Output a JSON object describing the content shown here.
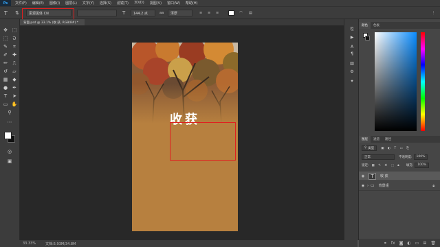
{
  "app": {
    "logo": "Ps"
  },
  "menu": [
    "文件(F)",
    "编辑(E)",
    "图像(I)",
    "图层(L)",
    "文字(Y)",
    "选择(S)",
    "滤镜(T)",
    "3D(D)",
    "视图(V)",
    "窗口(W)",
    "帮助(H)"
  ],
  "options": {
    "tool_glyph": "T",
    "orient_glyph": "⇅",
    "font_family": "思源黑体 CN",
    "font_style": "",
    "size_glyph": "T",
    "font_size": "144.2 点",
    "aa_glyph": "aa",
    "aa_mode": "浑厚"
  },
  "document": {
    "tab_label": "背面.psd @ 33.1% (收 获, RGB/8#) *",
    "canvas_text": "收获",
    "bg_color": "#b7803f"
  },
  "status": {
    "zoom": "33.33%",
    "doc_size": "文档:5.93M/34.8M"
  },
  "color_panel": {
    "tabs": [
      "颜色",
      "色板"
    ]
  },
  "layers_panel": {
    "tabs": [
      "图层",
      "通道",
      "路径"
    ],
    "filter_kind": "类型",
    "blend_mode": "正常",
    "opacity_label": "不透明度:",
    "opacity": "100%",
    "lock_label": "锁定:",
    "fill_label": "填充:",
    "fill": "100%",
    "layers": [
      {
        "name": "收 获",
        "thumb": "T",
        "selected": true
      },
      {
        "name": "背景组",
        "thumb": "▭",
        "selected": false
      }
    ]
  },
  "colors": {
    "accent_red": "#e02020",
    "ps_blue": "#31a8ff"
  }
}
